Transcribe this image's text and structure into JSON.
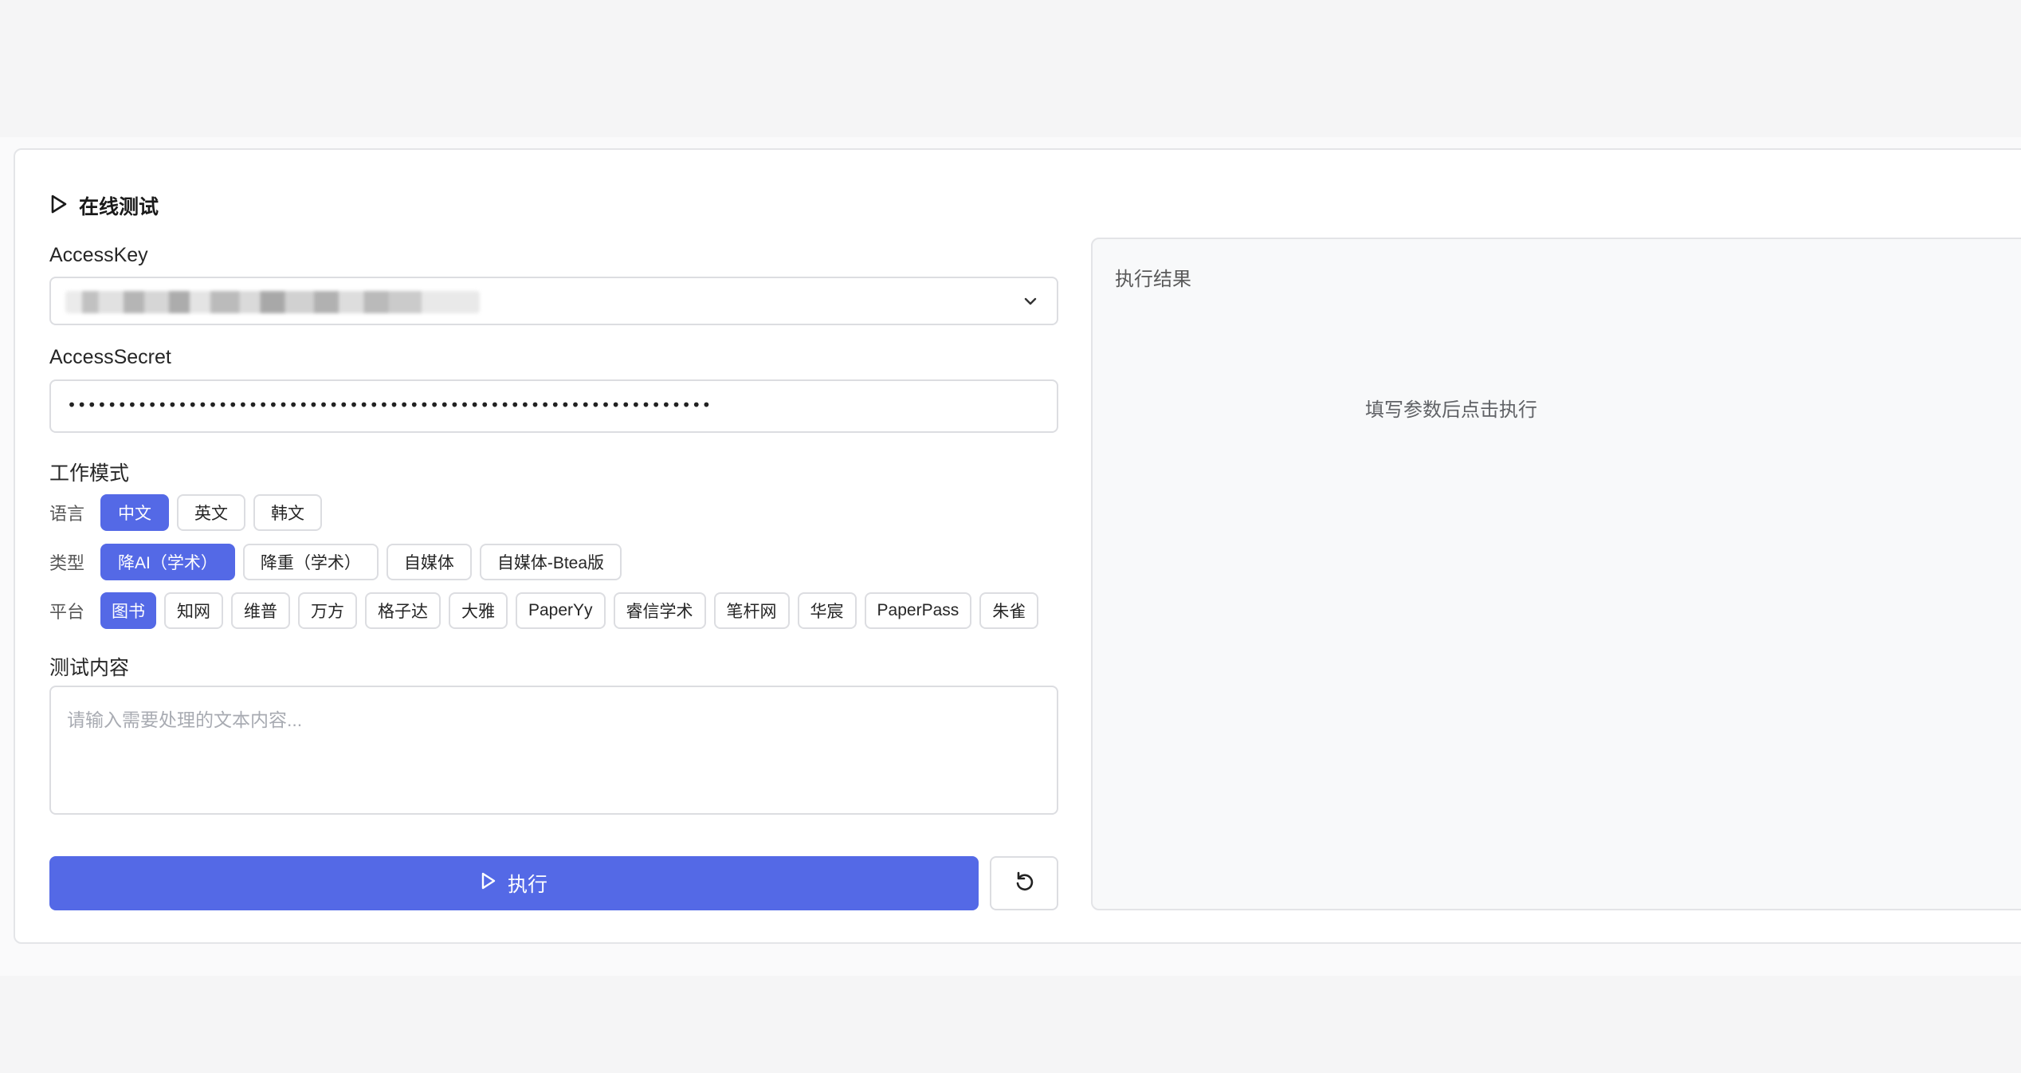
{
  "card": {
    "title": "在线测试"
  },
  "access_key": {
    "label": "AccessKey",
    "value_obscured": ""
  },
  "access_secret": {
    "label": "AccessSecret",
    "value": "••••••••••••••••••••••••••••••••••••••••••••••••••••••••••••••••"
  },
  "work_mode": {
    "label": "工作模式",
    "language": {
      "label": "语言",
      "options": [
        "中文",
        "英文",
        "韩文"
      ],
      "selected": "中文"
    },
    "type": {
      "label": "类型",
      "options": [
        "降AI（学术）",
        "降重（学术）",
        "自媒体",
        "自媒体-Btea版"
      ],
      "selected": "降AI（学术）"
    },
    "platform": {
      "label": "平台",
      "options": [
        "图书",
        "知网",
        "维普",
        "万方",
        "格子达",
        "大雅",
        "PaperYy",
        "睿信学术",
        "笔杆网",
        "华宸",
        "PaperPass",
        "朱雀"
      ],
      "selected": "图书"
    }
  },
  "test_content": {
    "label": "测试内容",
    "placeholder": "请输入需要处理的文本内容..."
  },
  "actions": {
    "run_label": "执行"
  },
  "result": {
    "title": "执行结果",
    "empty_text": "填写参数后点击执行"
  },
  "colors": {
    "accent": "#5469e6",
    "border": "#dcdde1",
    "panel_bg": "#f8f9fa"
  },
  "icons": {
    "header": "play-icon",
    "select": "chevron-down-icon",
    "run": "play-icon",
    "reset": "refresh-icon"
  }
}
